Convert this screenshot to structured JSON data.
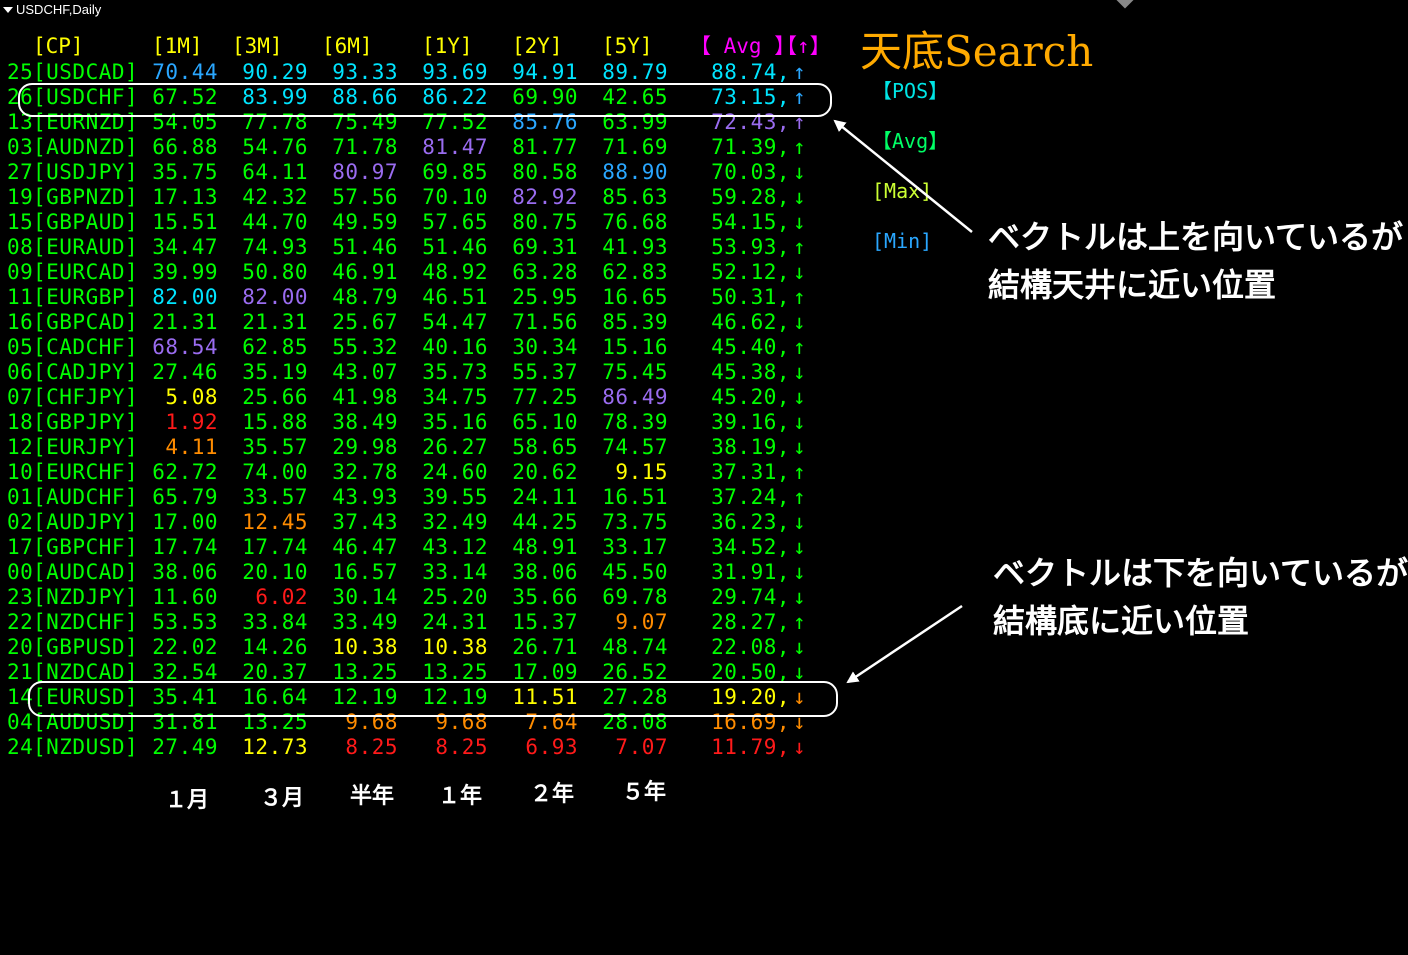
{
  "window": {
    "title": "USDCHF,Daily"
  },
  "brand": {
    "text": "天底Search",
    "color": "#ffaa00"
  },
  "legend": [
    {
      "label": "【POS】",
      "color": "#00e5e5"
    },
    {
      "label": "【Avg】",
      "color": "#00ff66"
    },
    {
      "label": "[Max]",
      "color": "#ccff33"
    },
    {
      "label": "[Min]",
      "color": "#2aa7ff"
    }
  ],
  "headers": [
    {
      "label": "[CP]",
      "color": "#ffff00"
    },
    {
      "label": "[1M]",
      "color": "#ffff00"
    },
    {
      "label": "[3M]",
      "color": "#ffff00"
    },
    {
      "label": "[6M]",
      "color": "#ffff00"
    },
    {
      "label": "[1Y]",
      "color": "#ffff00"
    },
    {
      "label": "[2Y]",
      "color": "#ffff00"
    },
    {
      "label": "[5Y]",
      "color": "#ffff00"
    },
    {
      "label": "【 Avg 】",
      "color": "#ff00ff"
    },
    {
      "label": "【↑】",
      "color": "#ff00ff"
    }
  ],
  "colors": {
    "green": "#00ff00",
    "cyan": "#00e5ff",
    "blue": "#2aa7ff",
    "purple": "#9a6cf0",
    "yellow": "#ffff00",
    "orange": "#ff8c00",
    "red": "#ff1a1a",
    "white": "#ffffff"
  },
  "rows": [
    {
      "no": "25",
      "pair": "[USDCAD]",
      "vals": [
        [
          "70.44",
          "blue"
        ],
        [
          "90.29",
          "cyan"
        ],
        [
          "93.33",
          "cyan"
        ],
        [
          "93.69",
          "cyan"
        ],
        [
          "94.91",
          "cyan"
        ],
        [
          "89.79",
          "cyan"
        ]
      ],
      "avg": [
        "88.74,",
        "cyan"
      ],
      "dir": [
        "↑",
        "blue"
      ]
    },
    {
      "no": "26",
      "pair": "[USDCHF]",
      "vals": [
        [
          "67.52",
          "green"
        ],
        [
          "83.99",
          "cyan"
        ],
        [
          "88.66",
          "cyan"
        ],
        [
          "86.22",
          "cyan"
        ],
        [
          "69.90",
          "green"
        ],
        [
          "42.65",
          "green"
        ]
      ],
      "avg": [
        "73.15,",
        "cyan"
      ],
      "dir": [
        "↑",
        "blue"
      ]
    },
    {
      "no": "13",
      "pair": "[EURNZD]",
      "vals": [
        [
          "54.05",
          "green"
        ],
        [
          "77.78",
          "green"
        ],
        [
          "75.49",
          "green"
        ],
        [
          "77.52",
          "green"
        ],
        [
          "85.76",
          "blue"
        ],
        [
          "63.99",
          "green"
        ]
      ],
      "avg": [
        "72.43,",
        "purple"
      ],
      "dir": [
        "↑",
        "purple"
      ]
    },
    {
      "no": "03",
      "pair": "[AUDNZD]",
      "vals": [
        [
          "66.88",
          "green"
        ],
        [
          "54.76",
          "green"
        ],
        [
          "71.78",
          "green"
        ],
        [
          "81.47",
          "purple"
        ],
        [
          "81.77",
          "green"
        ],
        [
          "71.69",
          "green"
        ]
      ],
      "avg": [
        "71.39,",
        "green"
      ],
      "dir": [
        "↑",
        "green"
      ]
    },
    {
      "no": "27",
      "pair": "[USDJPY]",
      "vals": [
        [
          "35.75",
          "green"
        ],
        [
          "64.11",
          "green"
        ],
        [
          "80.97",
          "purple"
        ],
        [
          "69.85",
          "green"
        ],
        [
          "80.58",
          "green"
        ],
        [
          "88.90",
          "blue"
        ]
      ],
      "avg": [
        "70.03,",
        "green"
      ],
      "dir": [
        "↓",
        "green"
      ]
    },
    {
      "no": "19",
      "pair": "[GBPNZD]",
      "vals": [
        [
          "17.13",
          "green"
        ],
        [
          "42.32",
          "green"
        ],
        [
          "57.56",
          "green"
        ],
        [
          "70.10",
          "green"
        ],
        [
          "82.92",
          "purple"
        ],
        [
          "85.63",
          "green"
        ]
      ],
      "avg": [
        "59.28,",
        "green"
      ],
      "dir": [
        "↓",
        "green"
      ]
    },
    {
      "no": "15",
      "pair": "[GBPAUD]",
      "vals": [
        [
          "15.51",
          "green"
        ],
        [
          "44.70",
          "green"
        ],
        [
          "49.59",
          "green"
        ],
        [
          "57.65",
          "green"
        ],
        [
          "80.75",
          "green"
        ],
        [
          "76.68",
          "green"
        ]
      ],
      "avg": [
        "54.15,",
        "green"
      ],
      "dir": [
        "↓",
        "green"
      ]
    },
    {
      "no": "08",
      "pair": "[EURAUD]",
      "vals": [
        [
          "34.47",
          "green"
        ],
        [
          "74.93",
          "green"
        ],
        [
          "51.46",
          "green"
        ],
        [
          "51.46",
          "green"
        ],
        [
          "69.31",
          "green"
        ],
        [
          "41.93",
          "green"
        ]
      ],
      "avg": [
        "53.93,",
        "green"
      ],
      "dir": [
        "↑",
        "green"
      ]
    },
    {
      "no": "09",
      "pair": "[EURCAD]",
      "vals": [
        [
          "39.99",
          "green"
        ],
        [
          "50.80",
          "green"
        ],
        [
          "46.91",
          "green"
        ],
        [
          "48.92",
          "green"
        ],
        [
          "63.28",
          "green"
        ],
        [
          "62.83",
          "green"
        ]
      ],
      "avg": [
        "52.12,",
        "green"
      ],
      "dir": [
        "↓",
        "green"
      ]
    },
    {
      "no": "11",
      "pair": "[EURGBP]",
      "vals": [
        [
          "82.00",
          "cyan"
        ],
        [
          "82.00",
          "purple"
        ],
        [
          "48.79",
          "green"
        ],
        [
          "46.51",
          "green"
        ],
        [
          "25.95",
          "green"
        ],
        [
          "16.65",
          "green"
        ]
      ],
      "avg": [
        "50.31,",
        "green"
      ],
      "dir": [
        "↑",
        "green"
      ]
    },
    {
      "no": "16",
      "pair": "[GBPCAD]",
      "vals": [
        [
          "21.31",
          "green"
        ],
        [
          "21.31",
          "green"
        ],
        [
          "25.67",
          "green"
        ],
        [
          "54.47",
          "green"
        ],
        [
          "71.56",
          "green"
        ],
        [
          "85.39",
          "green"
        ]
      ],
      "avg": [
        "46.62,",
        "green"
      ],
      "dir": [
        "↓",
        "green"
      ]
    },
    {
      "no": "05",
      "pair": "[CADCHF]",
      "vals": [
        [
          "68.54",
          "purple"
        ],
        [
          "62.85",
          "green"
        ],
        [
          "55.32",
          "green"
        ],
        [
          "40.16",
          "green"
        ],
        [
          "30.34",
          "green"
        ],
        [
          "15.16",
          "green"
        ]
      ],
      "avg": [
        "45.40,",
        "green"
      ],
      "dir": [
        "↑",
        "green"
      ]
    },
    {
      "no": "06",
      "pair": "[CADJPY]",
      "vals": [
        [
          "27.46",
          "green"
        ],
        [
          "35.19",
          "green"
        ],
        [
          "43.07",
          "green"
        ],
        [
          "35.73",
          "green"
        ],
        [
          "55.37",
          "green"
        ],
        [
          "75.45",
          "green"
        ]
      ],
      "avg": [
        "45.38,",
        "green"
      ],
      "dir": [
        "↓",
        "green"
      ]
    },
    {
      "no": "07",
      "pair": "[CHFJPY]",
      "vals": [
        [
          "5.08",
          "yellow"
        ],
        [
          "25.66",
          "green"
        ],
        [
          "41.98",
          "green"
        ],
        [
          "34.75",
          "green"
        ],
        [
          "77.25",
          "green"
        ],
        [
          "86.49",
          "purple"
        ]
      ],
      "avg": [
        "45.20,",
        "green"
      ],
      "dir": [
        "↓",
        "green"
      ]
    },
    {
      "no": "18",
      "pair": "[GBPJPY]",
      "vals": [
        [
          "1.92",
          "red"
        ],
        [
          "15.88",
          "green"
        ],
        [
          "38.49",
          "green"
        ],
        [
          "35.16",
          "green"
        ],
        [
          "65.10",
          "green"
        ],
        [
          "78.39",
          "green"
        ]
      ],
      "avg": [
        "39.16,",
        "green"
      ],
      "dir": [
        "↓",
        "green"
      ]
    },
    {
      "no": "12",
      "pair": "[EURJPY]",
      "vals": [
        [
          "4.11",
          "orange"
        ],
        [
          "35.57",
          "green"
        ],
        [
          "29.98",
          "green"
        ],
        [
          "26.27",
          "green"
        ],
        [
          "58.65",
          "green"
        ],
        [
          "74.57",
          "green"
        ]
      ],
      "avg": [
        "38.19,",
        "green"
      ],
      "dir": [
        "↓",
        "green"
      ]
    },
    {
      "no": "10",
      "pair": "[EURCHF]",
      "vals": [
        [
          "62.72",
          "green"
        ],
        [
          "74.00",
          "green"
        ],
        [
          "32.78",
          "green"
        ],
        [
          "24.60",
          "green"
        ],
        [
          "20.62",
          "green"
        ],
        [
          "9.15",
          "yellow"
        ]
      ],
      "avg": [
        "37.31,",
        "green"
      ],
      "dir": [
        "↑",
        "green"
      ]
    },
    {
      "no": "01",
      "pair": "[AUDCHF]",
      "vals": [
        [
          "65.79",
          "green"
        ],
        [
          "33.57",
          "green"
        ],
        [
          "43.93",
          "green"
        ],
        [
          "39.55",
          "green"
        ],
        [
          "24.11",
          "green"
        ],
        [
          "16.51",
          "green"
        ]
      ],
      "avg": [
        "37.24,",
        "green"
      ],
      "dir": [
        "↑",
        "green"
      ]
    },
    {
      "no": "02",
      "pair": "[AUDJPY]",
      "vals": [
        [
          "17.00",
          "green"
        ],
        [
          "12.45",
          "orange"
        ],
        [
          "37.43",
          "green"
        ],
        [
          "32.49",
          "green"
        ],
        [
          "44.25",
          "green"
        ],
        [
          "73.75",
          "green"
        ]
      ],
      "avg": [
        "36.23,",
        "green"
      ],
      "dir": [
        "↓",
        "green"
      ]
    },
    {
      "no": "17",
      "pair": "[GBPCHF]",
      "vals": [
        [
          "17.74",
          "green"
        ],
        [
          "17.74",
          "green"
        ],
        [
          "46.47",
          "green"
        ],
        [
          "43.12",
          "green"
        ],
        [
          "48.91",
          "green"
        ],
        [
          "33.17",
          "green"
        ]
      ],
      "avg": [
        "34.52,",
        "green"
      ],
      "dir": [
        "↓",
        "green"
      ]
    },
    {
      "no": "00",
      "pair": "[AUDCAD]",
      "vals": [
        [
          "38.06",
          "green"
        ],
        [
          "20.10",
          "green"
        ],
        [
          "16.57",
          "green"
        ],
        [
          "33.14",
          "green"
        ],
        [
          "38.06",
          "green"
        ],
        [
          "45.50",
          "green"
        ]
      ],
      "avg": [
        "31.91,",
        "green"
      ],
      "dir": [
        "↓",
        "green"
      ]
    },
    {
      "no": "23",
      "pair": "[NZDJPY]",
      "vals": [
        [
          "11.60",
          "green"
        ],
        [
          "6.02",
          "red"
        ],
        [
          "30.14",
          "green"
        ],
        [
          "25.20",
          "green"
        ],
        [
          "35.66",
          "green"
        ],
        [
          "69.78",
          "green"
        ]
      ],
      "avg": [
        "29.74,",
        "green"
      ],
      "dir": [
        "↓",
        "green"
      ]
    },
    {
      "no": "22",
      "pair": "[NZDCHF]",
      "vals": [
        [
          "53.53",
          "green"
        ],
        [
          "33.84",
          "green"
        ],
        [
          "33.49",
          "green"
        ],
        [
          "24.31",
          "green"
        ],
        [
          "15.37",
          "green"
        ],
        [
          "9.07",
          "orange"
        ]
      ],
      "avg": [
        "28.27,",
        "green"
      ],
      "dir": [
        "↑",
        "green"
      ]
    },
    {
      "no": "20",
      "pair": "[GBPUSD]",
      "vals": [
        [
          "22.02",
          "green"
        ],
        [
          "14.26",
          "green"
        ],
        [
          "10.38",
          "yellow"
        ],
        [
          "10.38",
          "yellow"
        ],
        [
          "26.71",
          "green"
        ],
        [
          "48.74",
          "green"
        ]
      ],
      "avg": [
        "22.08,",
        "green"
      ],
      "dir": [
        "↓",
        "green"
      ]
    },
    {
      "no": "21",
      "pair": "[NZDCAD]",
      "vals": [
        [
          "32.54",
          "green"
        ],
        [
          "20.37",
          "green"
        ],
        [
          "13.25",
          "green"
        ],
        [
          "13.25",
          "green"
        ],
        [
          "17.09",
          "green"
        ],
        [
          "26.52",
          "green"
        ]
      ],
      "avg": [
        "20.50,",
        "green"
      ],
      "dir": [
        "↓",
        "green"
      ]
    },
    {
      "no": "14",
      "pair": "[EURUSD]",
      "vals": [
        [
          "35.41",
          "green"
        ],
        [
          "16.64",
          "green"
        ],
        [
          "12.19",
          "green"
        ],
        [
          "12.19",
          "green"
        ],
        [
          "11.51",
          "yellow"
        ],
        [
          "27.28",
          "green"
        ]
      ],
      "avg": [
        "19.20,",
        "yellow"
      ],
      "dir": [
        "↓",
        "orange"
      ]
    },
    {
      "no": "04",
      "pair": "[AUDUSD]",
      "vals": [
        [
          "31.81",
          "green"
        ],
        [
          "13.25",
          "green"
        ],
        [
          "9.68",
          "orange"
        ],
        [
          "9.68",
          "orange"
        ],
        [
          "7.64",
          "orange"
        ],
        [
          "28.08",
          "green"
        ]
      ],
      "avg": [
        "16.69,",
        "orange"
      ],
      "dir": [
        "↓",
        "orange"
      ]
    },
    {
      "no": "24",
      "pair": "[NZDUSD]",
      "vals": [
        [
          "27.49",
          "green"
        ],
        [
          "12.73",
          "yellow"
        ],
        [
          "8.25",
          "red"
        ],
        [
          "8.25",
          "red"
        ],
        [
          "6.93",
          "red"
        ],
        [
          "7.07",
          "red"
        ]
      ],
      "avg": [
        "11.79,",
        "red"
      ],
      "dir": [
        "↓",
        "red"
      ]
    }
  ],
  "period_labels": [
    "１月",
    "３月",
    "半年",
    "１年",
    "２年",
    "５年"
  ],
  "annotations": {
    "top": {
      "line1": "ベクトルは上を向いているが",
      "line2": "結構天井に近い位置"
    },
    "bottom": {
      "line1": "ベクトルは下を向いているが",
      "line2": "結構底に近い位置"
    }
  }
}
